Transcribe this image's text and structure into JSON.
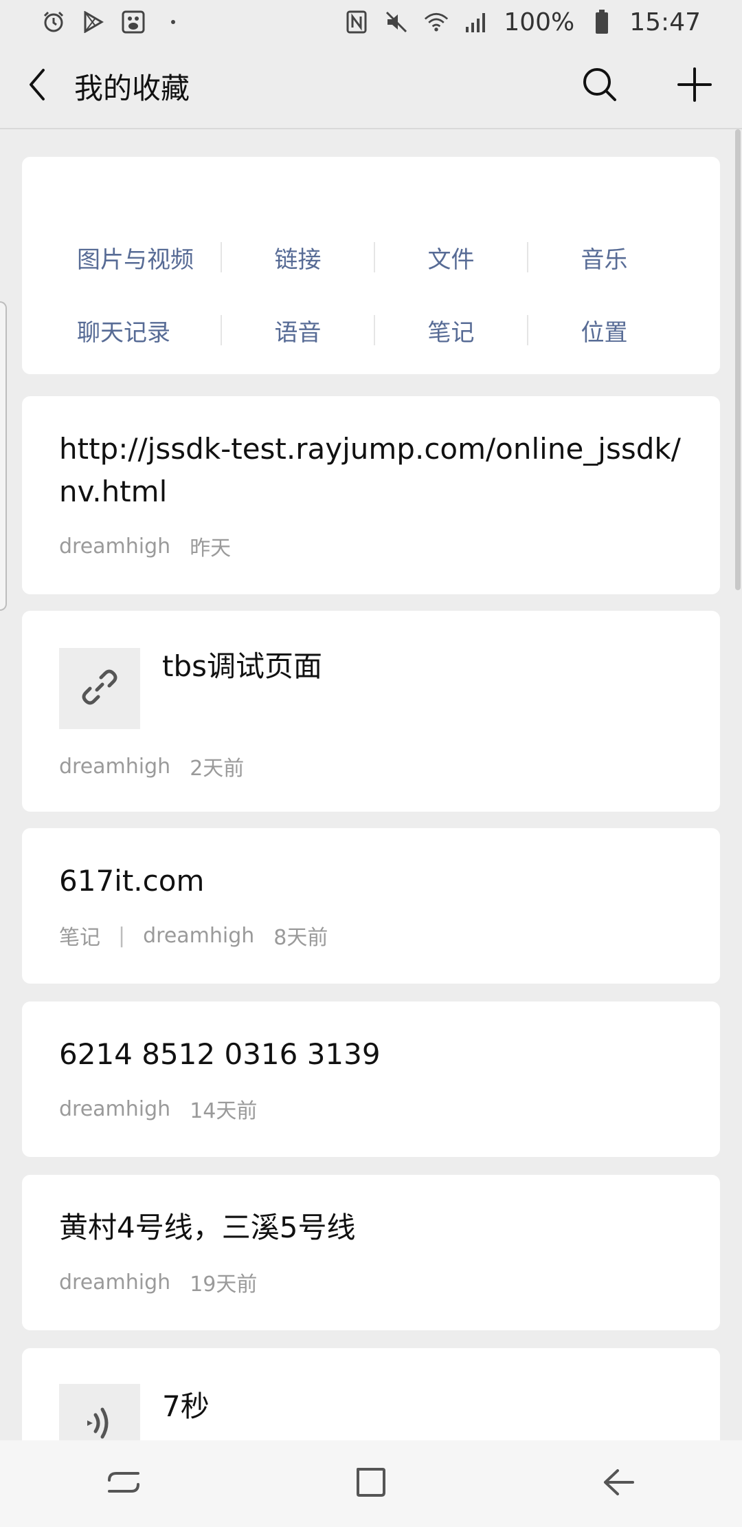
{
  "status_bar": {
    "battery_percent": "100%",
    "time": "15:47",
    "left_icons": [
      "alarm-icon",
      "play-store-icon",
      "baidu-icon",
      "dot-icon"
    ],
    "right_icons": [
      "nfc-icon",
      "mute-icon",
      "wifi-icon",
      "signal-icon",
      "battery-icon"
    ]
  },
  "header": {
    "title": "我的收藏",
    "back_icon": "chevron-left-icon",
    "search_icon": "search-icon",
    "add_icon": "plus-icon"
  },
  "categories": {
    "row1": [
      "图片与视频",
      "链接",
      "文件",
      "音乐"
    ],
    "row2": [
      "聊天记录",
      "语音",
      "笔记",
      "位置"
    ]
  },
  "items": [
    {
      "title": "http://jssdk-test.rayjump.com/online_jssdk/nv.html",
      "author": "dreamhigh",
      "time": "昨天"
    },
    {
      "title": "tbs调试页面",
      "author": "dreamhigh",
      "time": "2天前",
      "thumb_icon": "link-icon"
    },
    {
      "title": "617it.com",
      "type": "笔记",
      "separator": "|",
      "author": "dreamhigh",
      "time": "8天前"
    },
    {
      "title": "6214 8512 0316 3139",
      "author": "dreamhigh",
      "time": "14天前"
    },
    {
      "title": "黄村4号线，三溪5号线",
      "author": "dreamhigh",
      "time": "19天前"
    },
    {
      "title": "7秒",
      "thumb_icon": "voice-icon"
    }
  ],
  "nav_bar": [
    "recents-icon",
    "home-icon",
    "back-arrow-icon"
  ],
  "colors": {
    "background": "#ededed",
    "card": "#ffffff",
    "category_text": "#576b95",
    "meta_text": "#9a9a9a"
  }
}
